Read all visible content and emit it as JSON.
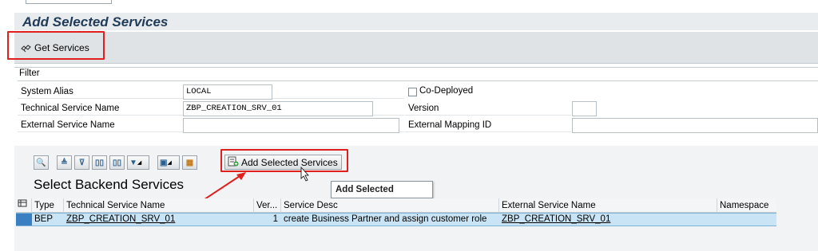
{
  "header": {
    "title": "Add Selected Services"
  },
  "toolbar": {
    "get_services_label": "Get Services"
  },
  "filter": {
    "title": "Filter",
    "system_alias_label": "System Alias",
    "system_alias_value": "LOCAL",
    "technical_service_name_label": "Technical Service Name",
    "technical_service_name_value": "ZBP_CREATION_SRV_01",
    "external_service_name_label": "External Service Name",
    "external_service_name_value": "",
    "co_deployed_label": "Co-Deployed",
    "co_deployed_checked": false,
    "version_label": "Version",
    "version_value": "",
    "external_mapping_id_label": "External Mapping ID",
    "external_mapping_id_value": ""
  },
  "alv": {
    "add_selected_label": "Add Selected Services",
    "tooltip": "Add Selected Services",
    "section_title": "Select Backend Services",
    "columns": {
      "type": "Type",
      "technical_service_name": "Technical Service Name",
      "version": "Ver...",
      "service_description": "Service Desc",
      "external_service_name": "External Service Name",
      "namespace": "Namespace"
    },
    "rows": [
      {
        "type": "BEP",
        "technical_service_name": "ZBP_CREATION_SRV_01",
        "version": "1",
        "service_description": "create Business Partner and assign customer role",
        "external_service_name": "ZBP_CREATION_SRV_01",
        "namespace": ""
      }
    ]
  },
  "colors": {
    "highlight_red": "#e0201c",
    "selected_row": "#c9e4f5",
    "title_blue": "#1f3b57"
  }
}
